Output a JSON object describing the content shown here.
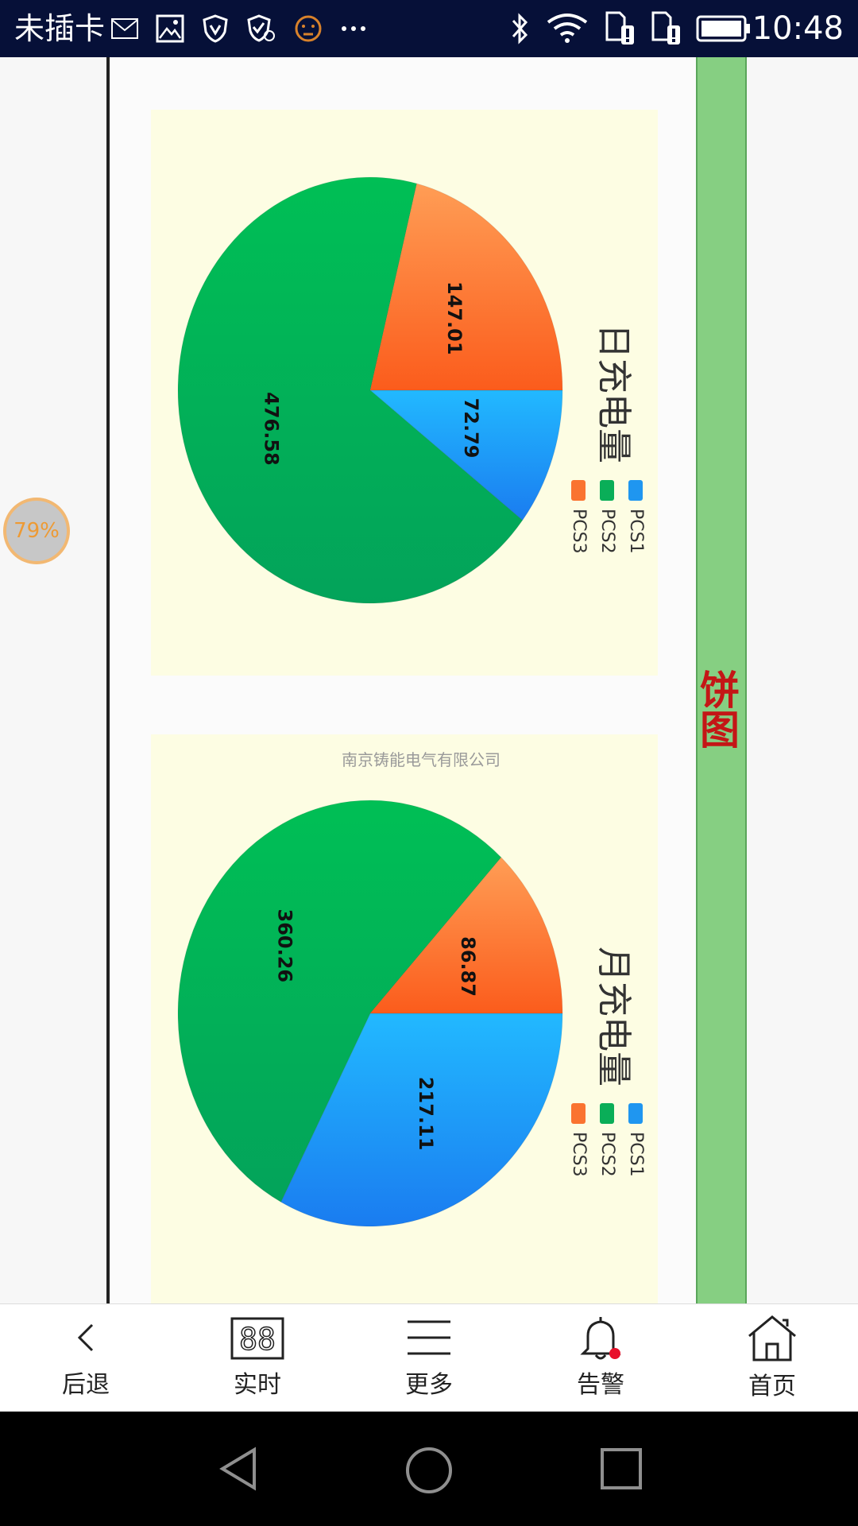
{
  "status_bar": {
    "carrier": "未插卡",
    "time": "10:48",
    "icons": [
      "mail-icon",
      "gallery-icon",
      "vpn-shield-icon",
      "shield-check-icon",
      "emoji-face-icon",
      "more-dots-icon",
      "bluetooth-icon",
      "wifi-icon",
      "sim-alert-icon",
      "sim-alert-icon",
      "battery-icon"
    ]
  },
  "badge": {
    "battery_percent": "79%"
  },
  "page": {
    "side_title": "饼图",
    "company": "南京铸能电气有限公司"
  },
  "charts": [
    {
      "title": "日充电量",
      "legend": [
        "PCS1",
        "PCS2",
        "PCS3"
      ]
    },
    {
      "title": "月充电量",
      "legend": [
        "PCS1",
        "PCS2",
        "PCS3"
      ]
    }
  ],
  "chart_data": [
    {
      "type": "pie",
      "title": "日充电量",
      "categories": [
        "PCS1",
        "PCS2",
        "PCS3"
      ],
      "values": [
        72.79,
        476.58,
        147.01
      ],
      "labels": [
        "72.79",
        "476.58",
        "147.01"
      ],
      "colors": [
        "#2a8ff0",
        "#06b156",
        "#fb6e2b"
      ],
      "legend_placement": "bottom-left"
    },
    {
      "type": "pie",
      "title": "月充电量",
      "categories": [
        "PCS1",
        "PCS2",
        "PCS3"
      ],
      "values": [
        217.11,
        360.26,
        86.87
      ],
      "labels": [
        "217.11",
        "360.26",
        "86.87"
      ],
      "colors": [
        "#2a8ff0",
        "#06b156",
        "#fb6e2b"
      ],
      "legend_placement": "bottom-left"
    }
  ],
  "bottom_nav": [
    {
      "label": "后退",
      "icon": "back-chevron-icon"
    },
    {
      "label": "实时",
      "icon": "digital-88-icon"
    },
    {
      "label": "更多",
      "icon": "menu-lines-icon"
    },
    {
      "label": "告警",
      "icon": "bell-icon"
    },
    {
      "label": "首页",
      "icon": "home-icon"
    }
  ],
  "android_nav": [
    "back-triangle-icon",
    "home-circle-icon",
    "recents-square-icon"
  ]
}
